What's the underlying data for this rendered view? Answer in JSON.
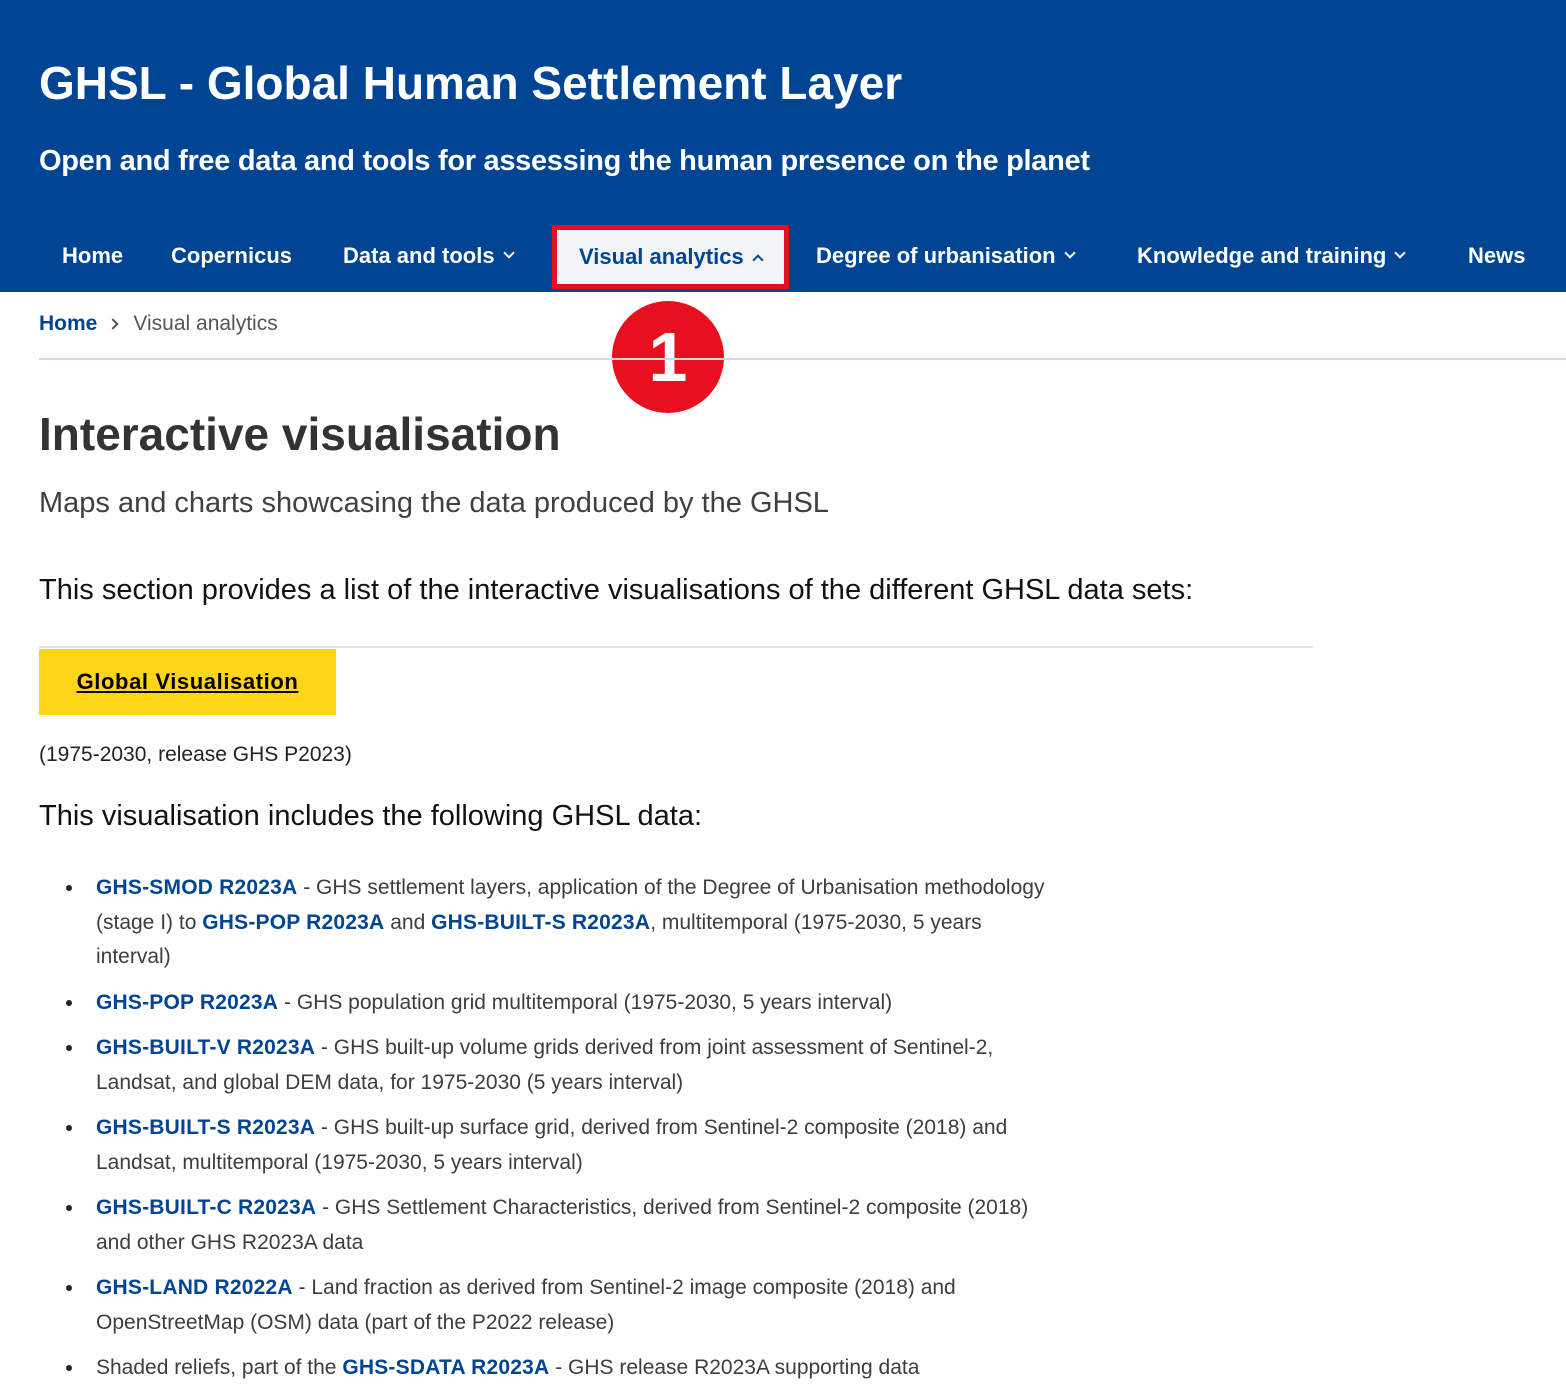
{
  "header": {
    "title": "GHSL - Global Human Settlement Layer",
    "subtitle": "Open and free data and tools for assessing the human presence on the planet"
  },
  "nav": {
    "home": "Home",
    "copernicus": "Copernicus",
    "data_tools": "Data and tools",
    "visual_analytics": "Visual analytics",
    "degree_urbanisation": "Degree of urbanisation",
    "knowledge_training": "Knowledge and training",
    "news": "News",
    "active_item": "Visual analytics",
    "highlight_color": "#e8101e"
  },
  "annotation": {
    "step_number": "1"
  },
  "breadcrumb": {
    "home": "Home",
    "current": "Visual analytics"
  },
  "main": {
    "title": "Interactive visualisation",
    "lead": "Maps and charts showcasing the data produced by the GHSL",
    "intro": "This section provides a list of the interactive visualisations of the different GHSL data sets:",
    "cta_label": "Global Visualisation",
    "release": "(1975-2030, release GHS P2023)",
    "includes_label": "This visualisation includes the following GHSL data:"
  },
  "data_list": {
    "item1": {
      "link": "GHS-SMOD R2023A",
      "text1": " - GHS settlement layers, application of the Degree of Urbanisation methodology (stage I) to ",
      "link2": "GHS-POP R2023A",
      "text2": " and ",
      "link3": "GHS-BUILT-S R2023A",
      "text3": ", multitemporal (1975-2030, 5 years interval)"
    },
    "item2": {
      "link": "GHS-POP R2023A",
      "text": " - GHS population grid multitemporal (1975-2030, 5 years interval)"
    },
    "item3": {
      "link": "GHS-BUILT-V R2023A",
      "text": " - GHS built-up volume grids derived from joint assessment of Sentinel-2, Landsat, and global DEM data, for 1975-2030 (5 years interval)"
    },
    "item4": {
      "link": "GHS-BUILT-S R2023A",
      "text": " - GHS built-up surface grid, derived from Sentinel-2 composite (2018) and Landsat, multitemporal (1975-2030, 5 years interval)"
    },
    "item5": {
      "link": "GHS-BUILT-C R2023A",
      "text": " - GHS Settlement Characteristics, derived from Sentinel-2 composite (2018) and other GHS R2023A data"
    },
    "item6": {
      "link": "GHS-LAND R2022A",
      "text": " - Land fraction as derived from Sentinel-2 image composite (2018) and OpenStreetMap (OSM) data (part of the P2022 release)"
    },
    "item7": {
      "prefix": "Shaded reliefs, part of the ",
      "link": "GHS-SDATA R2023A",
      "text": " - GHS release R2023A supporting data"
    }
  },
  "colors": {
    "header_bg": "#004494",
    "link": "#004494",
    "cta_bg": "#ffd617",
    "badge": "#e8101e"
  }
}
